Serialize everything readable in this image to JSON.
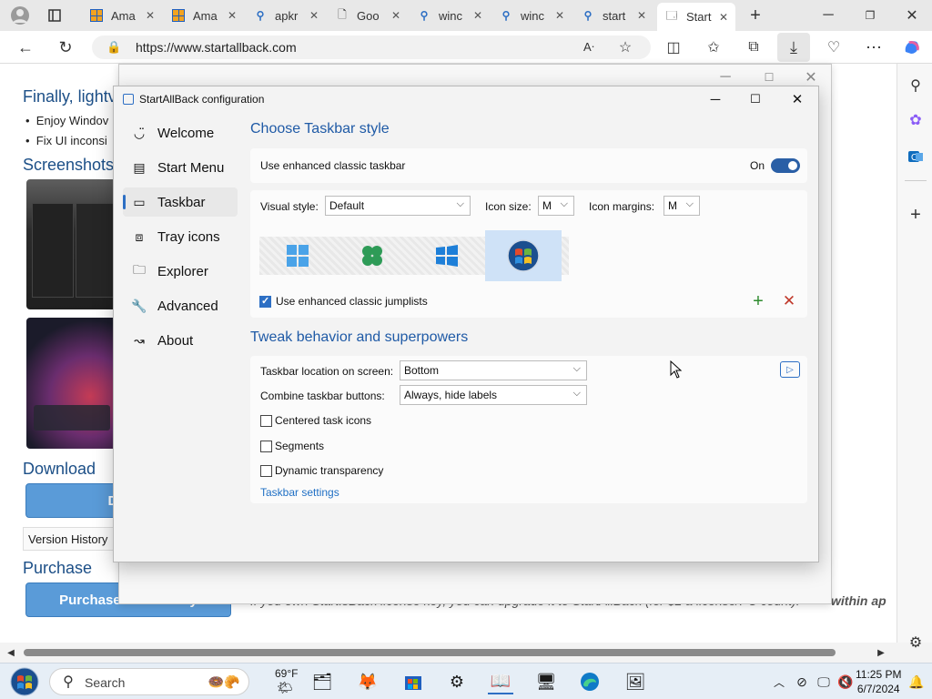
{
  "browser": {
    "tabs": [
      {
        "label": "Ama"
      },
      {
        "label": "Ama"
      },
      {
        "label": "apkr"
      },
      {
        "label": "Goo"
      },
      {
        "label": "winc"
      },
      {
        "label": "winc"
      },
      {
        "label": "start"
      },
      {
        "label": "Start"
      }
    ],
    "new_tab": "+",
    "url": "https://www.startallback.com"
  },
  "page": {
    "heading1": "Finally, lightv",
    "bullets": [
      "Enjoy Windov",
      "Fix UI inconsi"
    ],
    "screenshots": "Screenshots",
    "download": "Download",
    "download_button": "Downl",
    "version_history": "Version History",
    "purchase": "Purchase",
    "purchase_button": "Purchase license key",
    "bottom_text": "If you own StartIsBack license key, you can upgrade it to StartAllBack (for $2 a license/PC count).",
    "bottom_bold": "within ap"
  },
  "config": {
    "title": "StartAllBack configuration",
    "nav": [
      {
        "label": "Welcome",
        "icon": "smile-icon"
      },
      {
        "label": "Start Menu",
        "icon": "start-menu-icon"
      },
      {
        "label": "Taskbar",
        "icon": "taskbar-icon"
      },
      {
        "label": "Tray icons",
        "icon": "tray-icon"
      },
      {
        "label": "Explorer",
        "icon": "folder-icon"
      },
      {
        "label": "Advanced",
        "icon": "wrench-icon"
      },
      {
        "label": "About",
        "icon": "about-icon"
      }
    ],
    "section1": "Choose Taskbar style",
    "enhanced_taskbar": "Use enhanced classic taskbar",
    "toggle_state": "On",
    "visual_style_label": "Visual style:",
    "visual_style_value": "Default",
    "icon_size_label": "Icon size:",
    "icon_size_value": "M",
    "icon_margins_label": "Icon margins:",
    "icon_margins_value": "M",
    "jumplists": "Use enhanced classic jumplists",
    "section2": "Tweak behavior and superpowers",
    "location_label": "Taskbar location on screen:",
    "location_value": "Bottom",
    "combine_label": "Combine taskbar buttons:",
    "combine_value": "Always, hide labels",
    "centered": "Centered task icons",
    "segments": "Segments",
    "dynamic": "Dynamic transparency",
    "settings_link": "Taskbar settings"
  },
  "taskbar": {
    "search": "Search",
    "weather": "69°F",
    "time": "11:25 PM",
    "date": "6/7/2024"
  },
  "colors": {
    "accent": "#2d6fc4",
    "heading": "#1f5aa6",
    "page_button": "#5a9bd8"
  }
}
